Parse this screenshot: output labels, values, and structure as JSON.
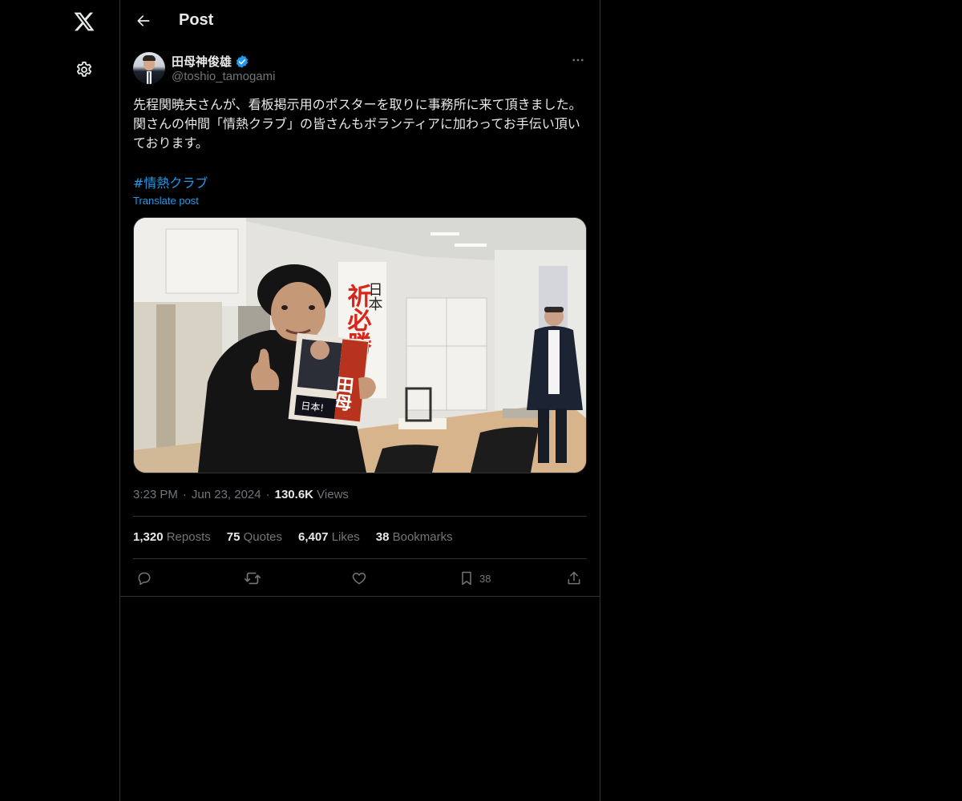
{
  "nav": {
    "items": [
      {
        "icon": "x-logo-icon"
      },
      {
        "icon": "gear-icon"
      }
    ]
  },
  "header": {
    "title": "Post"
  },
  "post": {
    "author_name": "田母神俊雄",
    "author_handle": "@toshio_tamogami",
    "verified": true,
    "text": "先程関暁夫さんが、看板掲示用のポスターを取りに事務所に来て頂きました。関さんの仲間「情熱クラブ」の皆さんもボランティアに加わってお手伝い頂いております。",
    "hashtag": "#情熱クラブ",
    "translate_label": "Translate post",
    "time": "3:23 PM",
    "date": "Jun 23, 2024",
    "views_count": "130.6K",
    "views_label": "Views",
    "separator": "·"
  },
  "stats": {
    "reposts_count": "1,320",
    "reposts_label": "Reposts",
    "quotes_count": "75",
    "quotes_label": "Quotes",
    "likes_count": "6,407",
    "likes_label": "Likes",
    "bookmarks_count": "38",
    "bookmarks_label": "Bookmarks"
  },
  "actions": {
    "bookmark_count": "38"
  },
  "colors": {
    "background": "#000000",
    "text": "#e7e9ea",
    "secondary": "#71767b",
    "accent": "#1d9bf0",
    "border": "#2f3336"
  }
}
